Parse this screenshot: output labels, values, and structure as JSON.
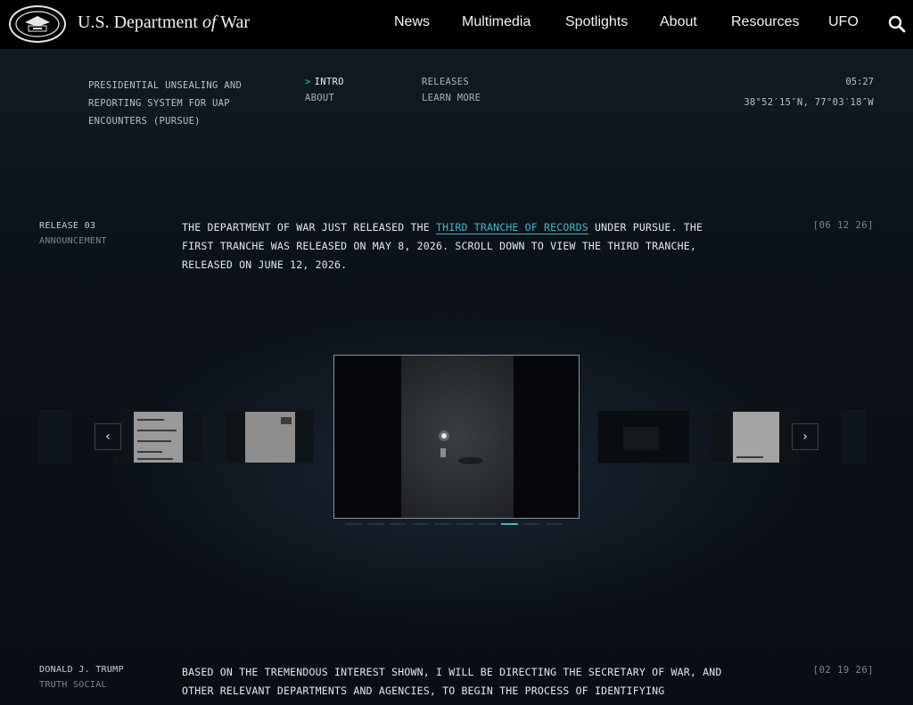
{
  "header": {
    "brand_prefix": "U.S. Department ",
    "brand_of": "of",
    "brand_suffix": " War",
    "nav": [
      "News",
      "Multimedia",
      "Spotlights",
      "About",
      "Resources",
      "UFO"
    ],
    "icons": {
      "seal": "department-seal-icon",
      "search": "search-icon"
    }
  },
  "subheader": {
    "program_title": "PRESIDENTIAL UNSEALING AND REPORTING SYSTEM FOR UAP ENCOUNTERS (PURSUE)",
    "subnav": [
      {
        "label": "INTRO",
        "active": true
      },
      {
        "label": "ABOUT",
        "active": false
      },
      {
        "label": "RELEASES",
        "active": false
      },
      {
        "label": "LEARN MORE",
        "active": false
      }
    ],
    "active_marker": ">",
    "clock": "05:27",
    "coordinates": "38°52′15″N, 77°03′18″W"
  },
  "entries": [
    {
      "label": "RELEASE 03",
      "sublabel": "ANNOUNCEMENT",
      "text_before": "THE DEPARTMENT OF WAR JUST RELEASED THE ",
      "link": "THIRD TRANCHE OF RECORDS",
      "text_after": " UNDER PURSUE. THE FIRST TRANCHE WAS RELEASED ON MAY 8, 2026. SCROLL DOWN TO VIEW THE THIRD TRANCHE, RELEASED ON JUNE 12, 2026.",
      "date": "[06 12 26]"
    },
    {
      "label": "DONALD J. TRUMP",
      "sublabel": "TRUTH SOCIAL",
      "text": "BASED ON THE TREMENDOUS INTEREST SHOWN, I WILL BE DIRECTING THE SECRETARY OF WAR, AND OTHER RELEVANT DEPARTMENTS AND AGENCIES, TO BEGIN THE PROCESS OF IDENTIFYING",
      "date": "[02 19 26]"
    }
  ],
  "carousel": {
    "prev_icon": "chevron-left-icon",
    "next_icon": "chevron-right-icon",
    "prev_glyph": "‹",
    "next_glyph": "›",
    "slide_count": 10,
    "active_slide": 7,
    "colors": {
      "accent": "#3fb6c7",
      "background": "#0b0f15"
    }
  }
}
